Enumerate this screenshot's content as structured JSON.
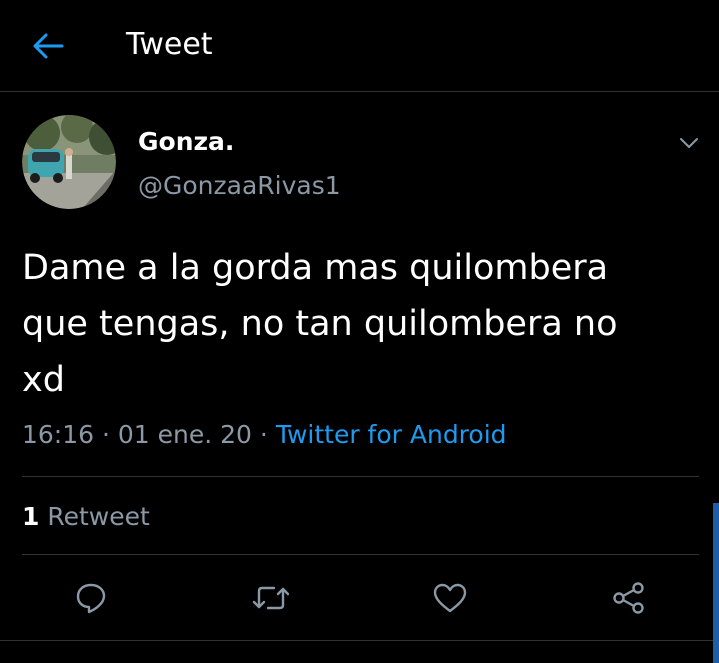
{
  "header": {
    "back_icon": "arrow-left-icon",
    "title": "Tweet"
  },
  "author": {
    "display_name": "Gonza.",
    "handle": "@GonzaaRivas1",
    "avatar_icon": "avatar-photo"
  },
  "tweet": {
    "text": "Dame a la gorda mas quilombera\nque tengas, no tan quilombera no\nxd",
    "time": "16:16",
    "separator": " · ",
    "date": "01 ene. 20",
    "source": "Twitter for Android"
  },
  "stats": {
    "retweet_count": "1",
    "retweet_label": " Retweet"
  },
  "actions": {
    "reply_icon": "reply-icon",
    "retweet_icon": "retweet-icon",
    "like_icon": "heart-icon",
    "share_icon": "share-icon"
  },
  "colors": {
    "background": "#000000",
    "text_primary": "#ffffff",
    "text_secondary": "#8b98a5",
    "accent": "#1d9bf0",
    "divider": "#2f3336"
  }
}
